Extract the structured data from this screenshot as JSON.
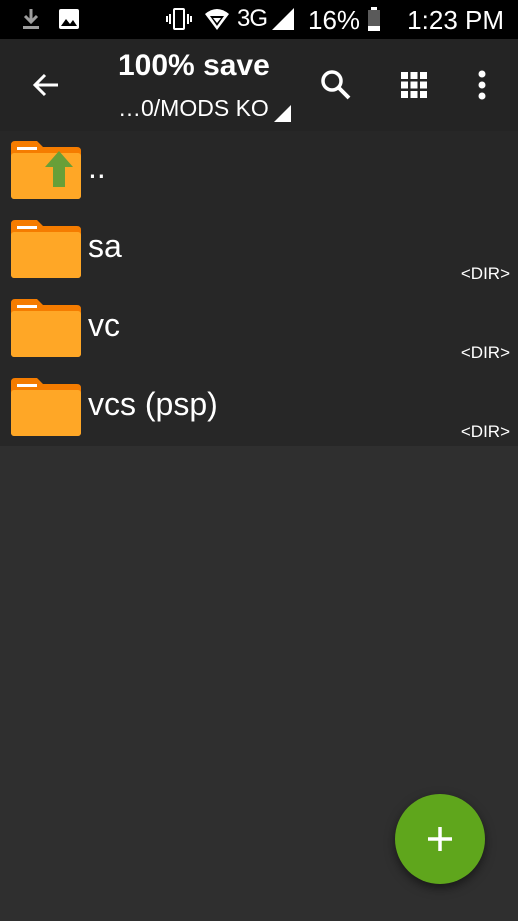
{
  "status_bar": {
    "network": "3G",
    "battery_percent": "16%",
    "time": "1:23 PM",
    "icons": [
      "download-icon",
      "gallery-icon",
      "vibrate-icon",
      "wifi-icon",
      "signal-icon",
      "battery-icon"
    ]
  },
  "app_bar": {
    "title": "100% save",
    "path": "…0/MODS KO",
    "icons": [
      "back-arrow-icon",
      "search-icon",
      "grid-view-icon",
      "more-vert-icon"
    ]
  },
  "files": [
    {
      "name": "..",
      "dir_label": "",
      "icon": "folder-up-icon"
    },
    {
      "name": "sa",
      "dir_label": "<DIR>",
      "icon": "folder-icon"
    },
    {
      "name": "vc",
      "dir_label": "<DIR>",
      "icon": "folder-icon"
    },
    {
      "name": "vcs (psp)",
      "dir_label": "<DIR>",
      "icon": "folder-icon"
    }
  ],
  "fab": {
    "icon": "plus-icon"
  },
  "colors": {
    "status_bar_bg": "#000000",
    "app_bar_bg": "#242424",
    "list_bg": "#272727",
    "background": "#2f2f2f",
    "folder_orange": "#ffa726",
    "folder_tab": "#f57c00",
    "up_arrow_green": "#689f38",
    "fab_green": "#5fa61c"
  }
}
